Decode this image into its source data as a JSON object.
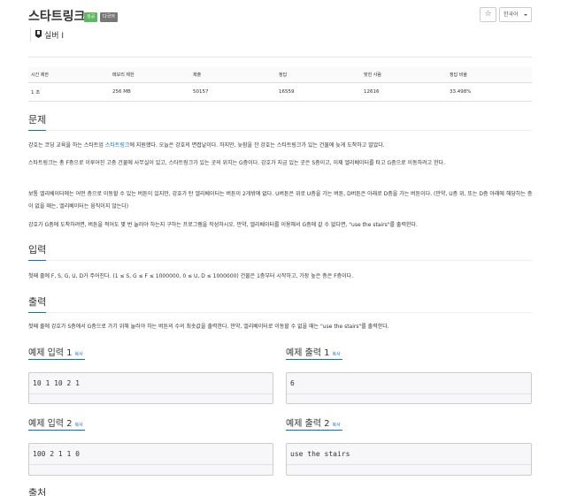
{
  "problem": {
    "title": "스타트링크",
    "badges": {
      "success": "성공",
      "multilingual": "다국어"
    },
    "star": "☆",
    "language": "한국어",
    "tier": "실버 I"
  },
  "stats": {
    "headers": [
      "시간 제한",
      "메모리 제한",
      "제출",
      "정답",
      "맞힌 사람",
      "정답 비율"
    ],
    "values": [
      "1 초",
      "256 MB",
      "50157",
      "16559",
      "12616",
      "33.498%"
    ]
  },
  "sections": {
    "problem_title": "문제",
    "problem_p1_prefix": "강호는 코딩 교육을 하는 스타트업 ",
    "problem_p1_link": "스타트링크",
    "problem_p1_suffix": "에 지원했다. 오늘은 강호의 면접날이다. 하지만, 늦잠을 잔 강호는 스타트링크가 있는 건물에 늦게 도착하고 말았다.",
    "problem_p2": "스타트링크는 총 F층으로 이루어진 고층 건물에 사무실이 있고, 스타트링크가 있는 곳의 위치는 G층이다. 강호가 지금 있는 곳은 S층이고, 이제 엘리베이터를 타고 G층으로 이동하려고 한다.",
    "problem_p3": "보통 엘리베이터에는 어떤 층으로 이동할 수 있는 버튼이 있지만, 강호가 탄 엘리베이터는 버튼이 2개밖에 없다. U버튼은 위로 U층을 가는 버튼, D버튼은 아래로 D층을 가는 버튼이다. (만약, U층 위, 또는 D층 아래에 해당하는 층이 없을 때는, 엘리베이터는 움직이지 않는다)",
    "problem_p4": "강호가 G층에 도착하려면, 버튼을 적어도 몇 번 눌러야 하는지 구하는 프로그램을 작성하시오. 만약, 엘리베이터를 이용해서 G층에 갈 수 없다면, \"use the stairs\"를 출력한다.",
    "input_title": "입력",
    "input_text": "첫째 줄에 F, S, G, U, D가 주어진다. (1 ≤ S, G ≤ F ≤ 1000000, 0 ≤ U, D ≤ 1000000) 건물은 1층부터 시작하고, 가장 높은 층은 F층이다.",
    "output_title": "출력",
    "output_text": "첫째 줄에 강호가 S층에서 G층으로 가기 위해 눌러야 하는 버튼의 수의 최솟값을 출력한다. 만약, 엘리베이터로 이동할 수 없을 때는 \"use the stairs\"를 출력한다.",
    "source_title": "출처"
  },
  "samples": {
    "copy_label": "복사",
    "input1_title": "예제 입력 1",
    "input1": "10 1 10 2 1",
    "output1_title": "예제 출력 1",
    "output1": "6",
    "input2_title": "예제 입력 2",
    "input2": "100 2 1 1 0",
    "output2_title": "예제 출력 2",
    "output2": "use the stairs"
  }
}
